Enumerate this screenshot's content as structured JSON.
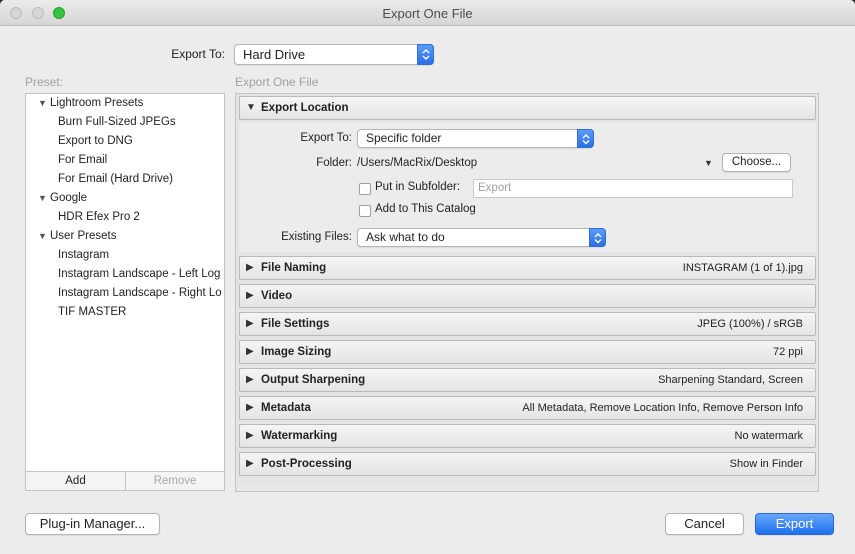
{
  "window": {
    "title": "Export One File"
  },
  "export_to": {
    "label": "Export To:",
    "value": "Hard Drive"
  },
  "preset": {
    "label": "Preset:",
    "folders": [
      {
        "name": "Lightroom Presets",
        "items": [
          "Burn Full-Sized JPEGs",
          "Export to DNG",
          "For Email",
          "For Email (Hard Drive)"
        ]
      },
      {
        "name": "Google",
        "items": [
          "HDR Efex Pro 2"
        ]
      },
      {
        "name": "User Presets",
        "items": [
          "Instagram",
          "Instagram Landscape - Left Log",
          "Instagram Landscape - Right Lo",
          "TIF MASTER"
        ]
      }
    ],
    "add_label": "Add",
    "remove_label": "Remove"
  },
  "panel_caption": "Export One File",
  "export_location": {
    "title": "Export Location",
    "export_to_label": "Export To:",
    "export_to_value": "Specific folder",
    "folder_label": "Folder:",
    "folder_value": "/Users/MacRix/Desktop",
    "choose_label": "Choose...",
    "subfolder_label": "Put in Subfolder:",
    "subfolder_placeholder": "Export",
    "add_catalog_label": "Add to This Catalog",
    "existing_files_label": "Existing Files:",
    "existing_files_value": "Ask what to do"
  },
  "sections": [
    {
      "name": "File Naming",
      "summary": "INSTAGRAM (1 of 1).jpg"
    },
    {
      "name": "Video",
      "summary": ""
    },
    {
      "name": "File Settings",
      "summary": "JPEG (100%) / sRGB"
    },
    {
      "name": "Image Sizing",
      "summary": "72 ppi"
    },
    {
      "name": "Output Sharpening",
      "summary": "Sharpening Standard, Screen"
    },
    {
      "name": "Metadata",
      "summary": "All Metadata, Remove Location Info, Remove Person Info"
    },
    {
      "name": "Watermarking",
      "summary": "No watermark"
    },
    {
      "name": "Post-Processing",
      "summary": "Show in Finder"
    }
  ],
  "footer": {
    "plugin_manager_label": "Plug-in Manager...",
    "cancel_label": "Cancel",
    "export_label": "Export"
  },
  "colors": {
    "accent": "#2a6fe6",
    "zoom_button": "#36c241"
  }
}
